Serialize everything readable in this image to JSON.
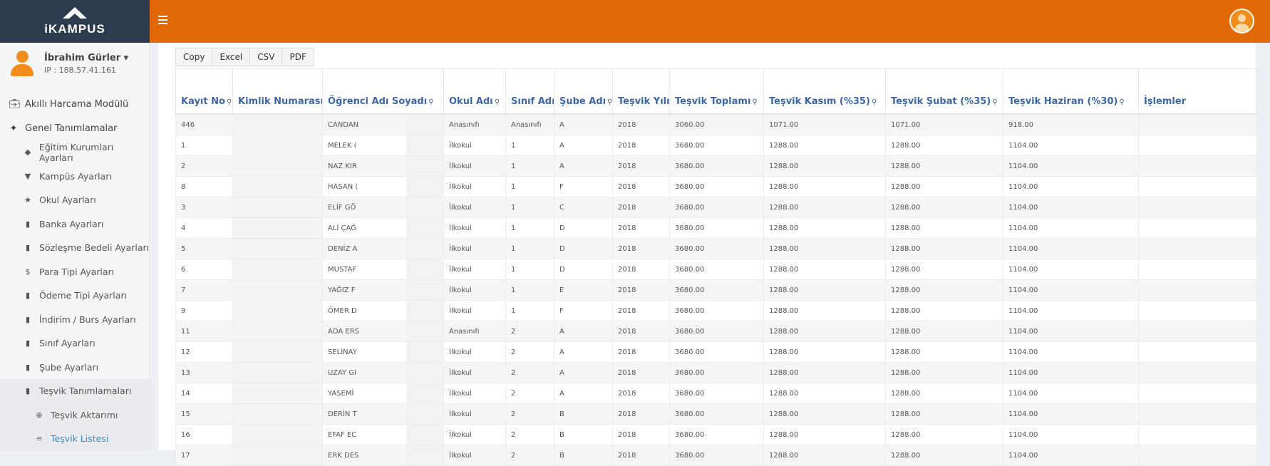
{
  "brand": {
    "name": "iKAMPUS"
  },
  "user": {
    "name": "İbrahim Gürler ▾",
    "ip": "IP : 188.57.41.161"
  },
  "menu": [
    {
      "label": "Akıllı Harcama Modülü",
      "icon": "briefcase-icon",
      "level": 0
    },
    {
      "label": "Genel Tanımlamalar",
      "icon": "puzzle-icon",
      "level": 0
    },
    {
      "label": "Eğitim Kurumları Ayarları",
      "icon": "graduation-cap-icon",
      "level": 1
    },
    {
      "label": "Kampüs Ayarları",
      "icon": "map-marker-icon",
      "level": 1
    },
    {
      "label": "Okul Ayarları",
      "icon": "star-icon",
      "level": 1
    },
    {
      "label": "Banka Ayarları",
      "icon": "bookmark-icon",
      "level": 1
    },
    {
      "label": "Sözleşme Bedeli Ayarları",
      "icon": "bookmark-icon",
      "level": 1
    },
    {
      "label": "Para Tipi Ayarları",
      "icon": "dollar-icon",
      "level": 1
    },
    {
      "label": "Ödeme Tipi Ayarları",
      "icon": "bookmark-icon",
      "level": 1
    },
    {
      "label": "İndirim / Burs Ayarları",
      "icon": "bookmark-icon",
      "level": 1
    },
    {
      "label": "Sınıf Ayarları",
      "icon": "bookmark-icon",
      "level": 1
    },
    {
      "label": "Şube Ayarları",
      "icon": "bookmark-icon",
      "level": 1
    },
    {
      "label": "Teşvik Tanımlamaları",
      "icon": "bookmark-icon",
      "level": 1
    },
    {
      "label": "Teşvik Aktarımı",
      "icon": "plus-circle-icon",
      "level": 2
    },
    {
      "label": "Teşvik Listesi",
      "icon": "list-icon",
      "level": 2
    }
  ],
  "export_buttons": [
    "Copy",
    "Excel",
    "CSV",
    "PDF"
  ],
  "table": {
    "columns": [
      {
        "label": "Kayıt No",
        "search": true
      },
      {
        "label": "Kimlik Numarası",
        "search": true
      },
      {
        "label": "Öğrenci Adı Soyadı",
        "search": true
      },
      {
        "label": "Okul Adı",
        "search": true
      },
      {
        "label": "Sınıf Adı",
        "search": true
      },
      {
        "label": "Şube Adı",
        "search": true
      },
      {
        "label": "Teşvik Yılı",
        "search": true
      },
      {
        "label": "Teşvik Toplamı",
        "search": true
      },
      {
        "label": "Teşvik Kasım (%35)",
        "search": true
      },
      {
        "label": "Teşvik Şubat (%35)",
        "search": true
      },
      {
        "label": "Teşvik Haziran (%30)",
        "search": true
      },
      {
        "label": "İşlemler",
        "search": false
      }
    ],
    "rows": [
      [
        "446",
        "",
        "CANDAN",
        "Anasınıfı",
        "Anasınıfı",
        "A",
        "2018",
        "3060.00",
        "1071.00",
        "1071.00",
        "918.00",
        ""
      ],
      [
        "1",
        "",
        "MELEK (",
        "İlkokul",
        "1",
        "A",
        "2018",
        "3680.00",
        "1288.00",
        "1288.00",
        "1104.00",
        ""
      ],
      [
        "2",
        "",
        "NAZ KIR",
        "İlkokul",
        "1",
        "A",
        "2018",
        "3680.00",
        "1288.00",
        "1288.00",
        "1104.00",
        ""
      ],
      [
        "8",
        "",
        "HASAN (",
        "İlkokul",
        "1",
        "F",
        "2018",
        "3680.00",
        "1288.00",
        "1288.00",
        "1104.00",
        ""
      ],
      [
        "3",
        "",
        "ELİF GÖ",
        "İlkokul",
        "1",
        "C",
        "2018",
        "3680.00",
        "1288.00",
        "1288.00",
        "1104.00",
        ""
      ],
      [
        "4",
        "",
        "ALİ ÇAĞ",
        "İlkokul",
        "1",
        "D",
        "2018",
        "3680.00",
        "1288.00",
        "1288.00",
        "1104.00",
        ""
      ],
      [
        "5",
        "",
        "DENİZ A",
        "İlkokul",
        "1",
        "D",
        "2018",
        "3680.00",
        "1288.00",
        "1288.00",
        "1104.00",
        ""
      ],
      [
        "6",
        "",
        "MUSTAF",
        "İlkokul",
        "1",
        "D",
        "2018",
        "3680.00",
        "1288.00",
        "1288.00",
        "1104.00",
        ""
      ],
      [
        "7",
        "",
        "YAĞIZ F",
        "İlkokul",
        "1",
        "E",
        "2018",
        "3680.00",
        "1288.00",
        "1288.00",
        "1104.00",
        ""
      ],
      [
        "9",
        "",
        "ÖMER D",
        "İlkokul",
        "1",
        "F",
        "2018",
        "3680.00",
        "1288.00",
        "1288.00",
        "1104.00",
        ""
      ],
      [
        "11",
        "",
        "ADA ERS",
        "Anasınıfı",
        "2",
        "A",
        "2018",
        "3680.00",
        "1288.00",
        "1288.00",
        "1104.00",
        ""
      ],
      [
        "12",
        "",
        "SELİNAY",
        "İlkokul",
        "2",
        "A",
        "2018",
        "3680.00",
        "1288.00",
        "1288.00",
        "1104.00",
        ""
      ],
      [
        "13",
        "",
        "UZAY GI",
        "İlkokul",
        "2",
        "A",
        "2018",
        "3680.00",
        "1288.00",
        "1288.00",
        "1104.00",
        ""
      ],
      [
        "14",
        "",
        "YASEMİ",
        "İlkokul",
        "2",
        "A",
        "2018",
        "3680.00",
        "1288.00",
        "1288.00",
        "1104.00",
        ""
      ],
      [
        "15",
        "",
        "DERİN T",
        "İlkokul",
        "2",
        "B",
        "2018",
        "3680.00",
        "1288.00",
        "1288.00",
        "1104.00",
        ""
      ],
      [
        "16",
        "",
        "EFAF EC",
        "İlkokul",
        "2",
        "B",
        "2018",
        "3680.00",
        "1288.00",
        "1288.00",
        "1104.00",
        ""
      ],
      [
        "17",
        "",
        "ERK DES",
        "İlkokul",
        "2",
        "B",
        "2018",
        "3680.00",
        "1288.00",
        "1288.00",
        "1104.00",
        ""
      ]
    ]
  },
  "colors": {
    "topbar": "#e26908",
    "brand_bg": "#2d3b4e",
    "header_text": "#3d67a7",
    "link_active": "#3c8dbc"
  }
}
